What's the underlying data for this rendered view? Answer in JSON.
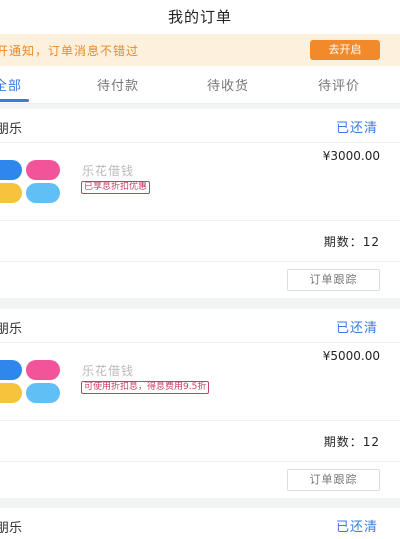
{
  "header": {
    "title": "我的订单"
  },
  "notice": {
    "text": "开通知，订单消息不错过",
    "button": "去开启"
  },
  "tabs": [
    {
      "label": "全部",
      "active": true
    },
    {
      "label": "待付款",
      "active": false
    },
    {
      "label": "待收货",
      "active": false
    },
    {
      "label": "待评价",
      "active": false
    }
  ],
  "orders": [
    {
      "shop": "朋乐",
      "status": "已还清",
      "product": "乐花借钱",
      "tag": "已享息折扣优惠",
      "price": "¥3000.00",
      "periods_label": "期数：",
      "periods": "12",
      "track_button": "订单跟踪"
    },
    {
      "shop": "朋乐",
      "status": "已还清",
      "product": "乐花借钱",
      "tag": "可使用折扣息，得息费用9.5折",
      "price": "¥5000.00",
      "periods_label": "期数：",
      "periods": "12",
      "track_button": "订单跟踪"
    },
    {
      "shop": "朋乐",
      "status": "已还清"
    }
  ],
  "colors": {
    "accent": "#3a7be0",
    "notice_bg": "#fdf1dd",
    "notice_button": "#f28a2b",
    "tag": "#c94064"
  }
}
